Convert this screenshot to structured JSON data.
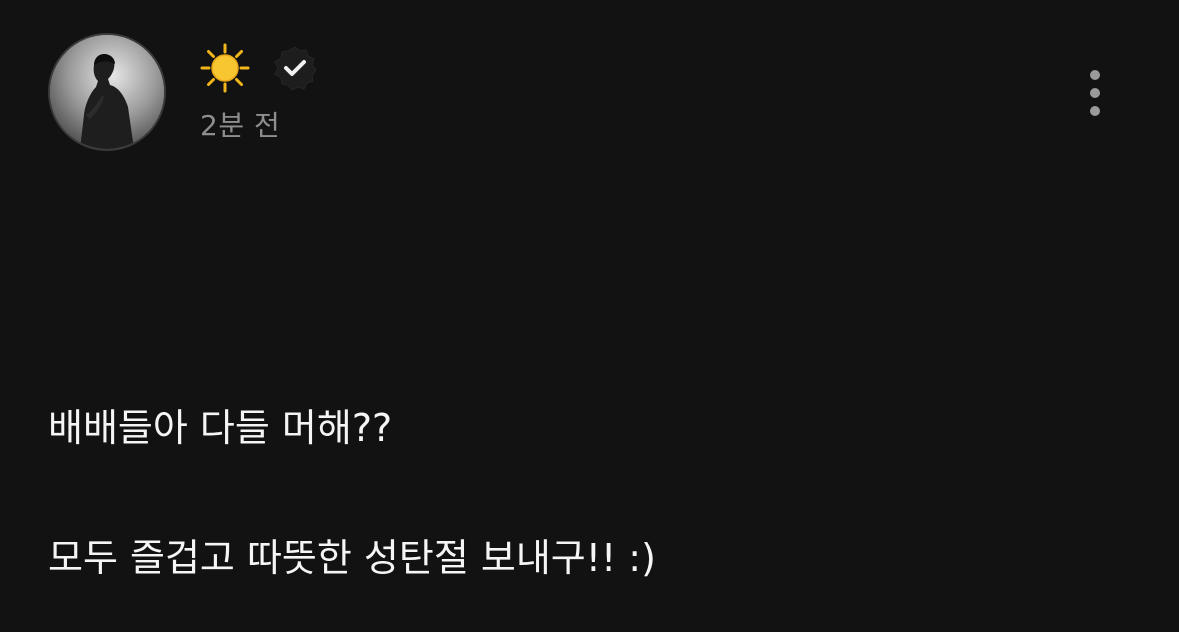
{
  "post": {
    "author": {
      "avatar": "profile-photo",
      "display_name_icon": "sun-emoji",
      "verified_icon": "verified-badge-icon"
    },
    "timestamp": "2분 전",
    "menu_icon": "more-vertical-icon",
    "content": {
      "line1": "배배들아 다들 머해??",
      "line2": "모두 즐겁고 따뜻한 성탄절 보내구!! :)"
    }
  },
  "colors": {
    "background": "#121212",
    "text": "#f5f5f5",
    "muted_text": "#8e8e8e",
    "verified_badge": "#1c1c1c",
    "sun": "#f6c22b"
  }
}
